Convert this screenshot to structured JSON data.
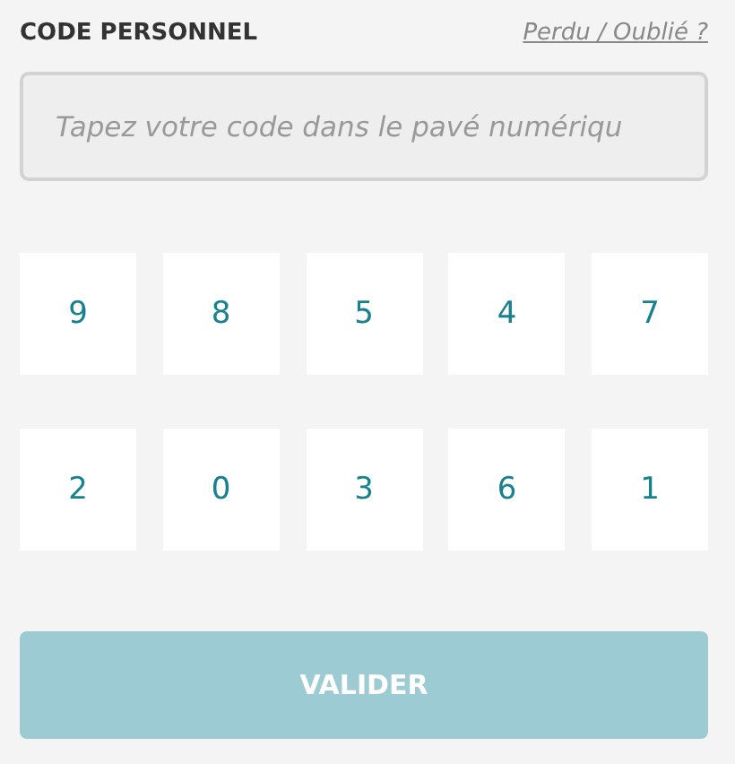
{
  "header": {
    "title": "CODE PERSONNEL",
    "link": "Perdu / Oublié ?"
  },
  "code_field": {
    "placeholder": "Tapez votre code dans le pavé numériqu"
  },
  "keypad": {
    "rows": [
      [
        "9",
        "8",
        "5",
        "4",
        "7"
      ],
      [
        "2",
        "0",
        "3",
        "6",
        "1"
      ]
    ]
  },
  "submit_button": {
    "label": "VALIDER",
    "disabled": true
  }
}
